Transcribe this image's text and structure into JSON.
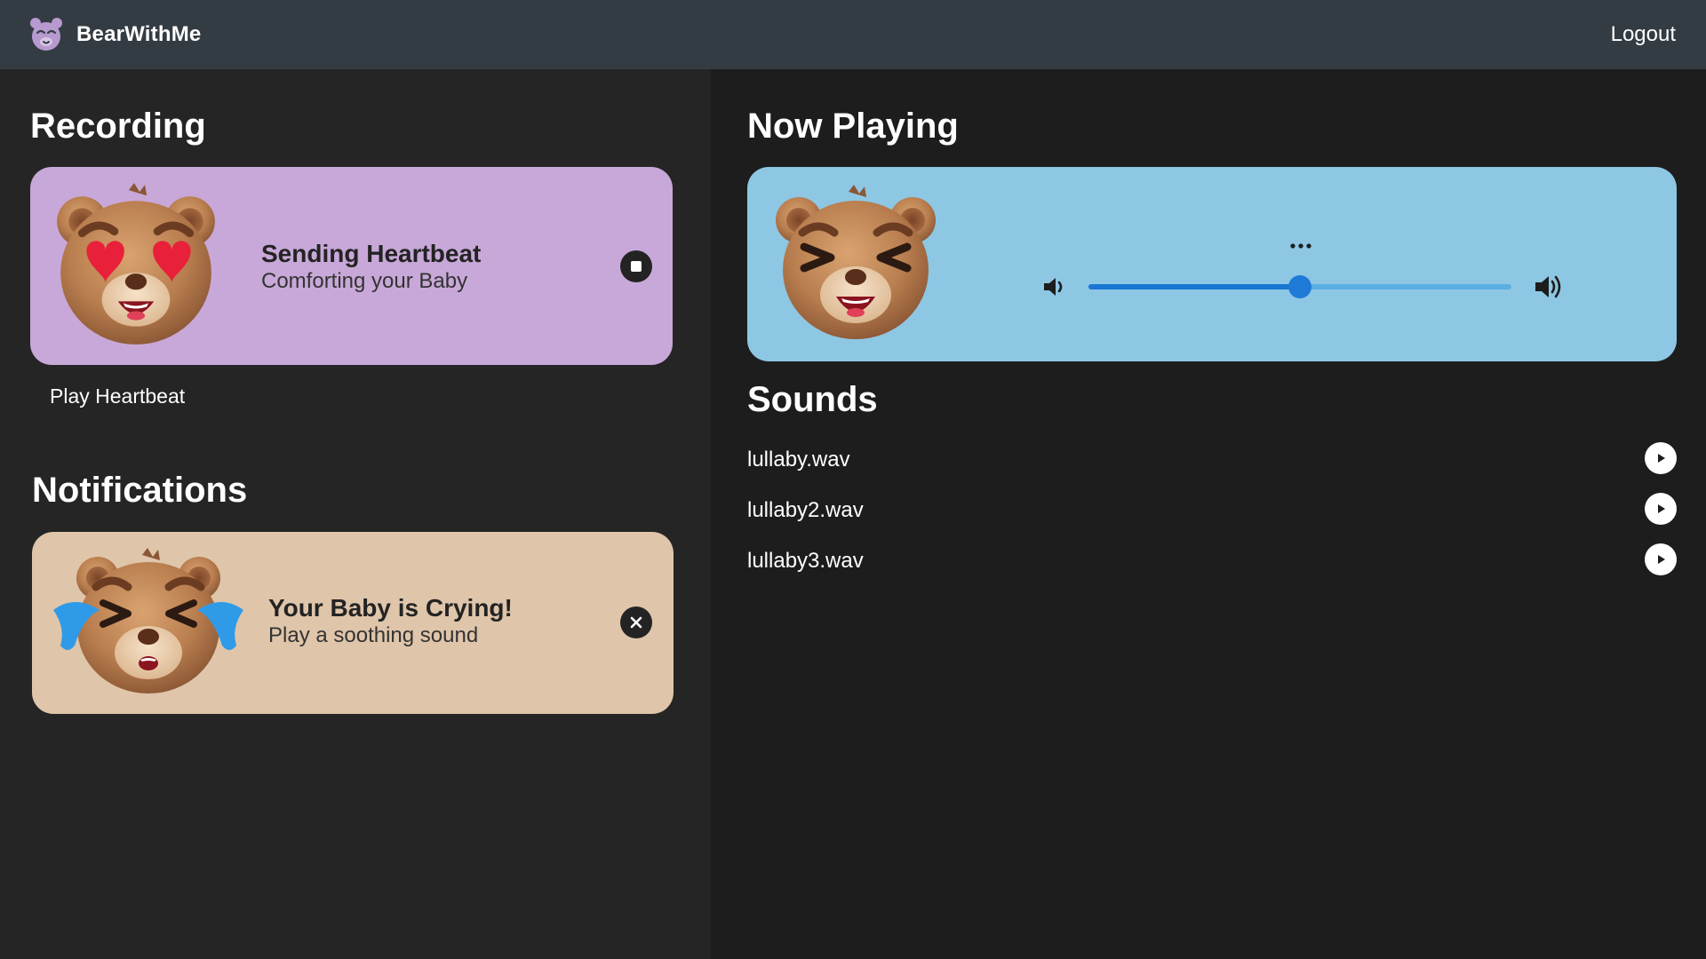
{
  "header": {
    "app_name": "BearWithMe",
    "logo_icon": "bear-logo-icon",
    "logout_label": "Logout"
  },
  "recording": {
    "title": "Recording",
    "card": {
      "title": "Sending Heartbeat",
      "subtitle": "Comforting your Baby",
      "image": "bear-heart-eyes",
      "action_icon": "stop-icon",
      "color": "#c8a8d8"
    },
    "play_label": "Play Heartbeat"
  },
  "notifications": {
    "title": "Notifications",
    "card": {
      "title": "Your Baby is Crying!",
      "subtitle": "Play a soothing sound",
      "image": "bear-crying",
      "action_icon": "close-icon",
      "color": "#dfc5aa"
    }
  },
  "now_playing": {
    "title": "Now Playing",
    "image": "bear-laughing",
    "menu_icon": "more-horizontal-icon",
    "volume_fraction": 0.5,
    "color": "#8ec7e4"
  },
  "sounds": {
    "title": "Sounds",
    "items": [
      {
        "name": "lullaby.wav"
      },
      {
        "name": "lullaby2.wav"
      },
      {
        "name": "lullaby3.wav"
      }
    ]
  }
}
